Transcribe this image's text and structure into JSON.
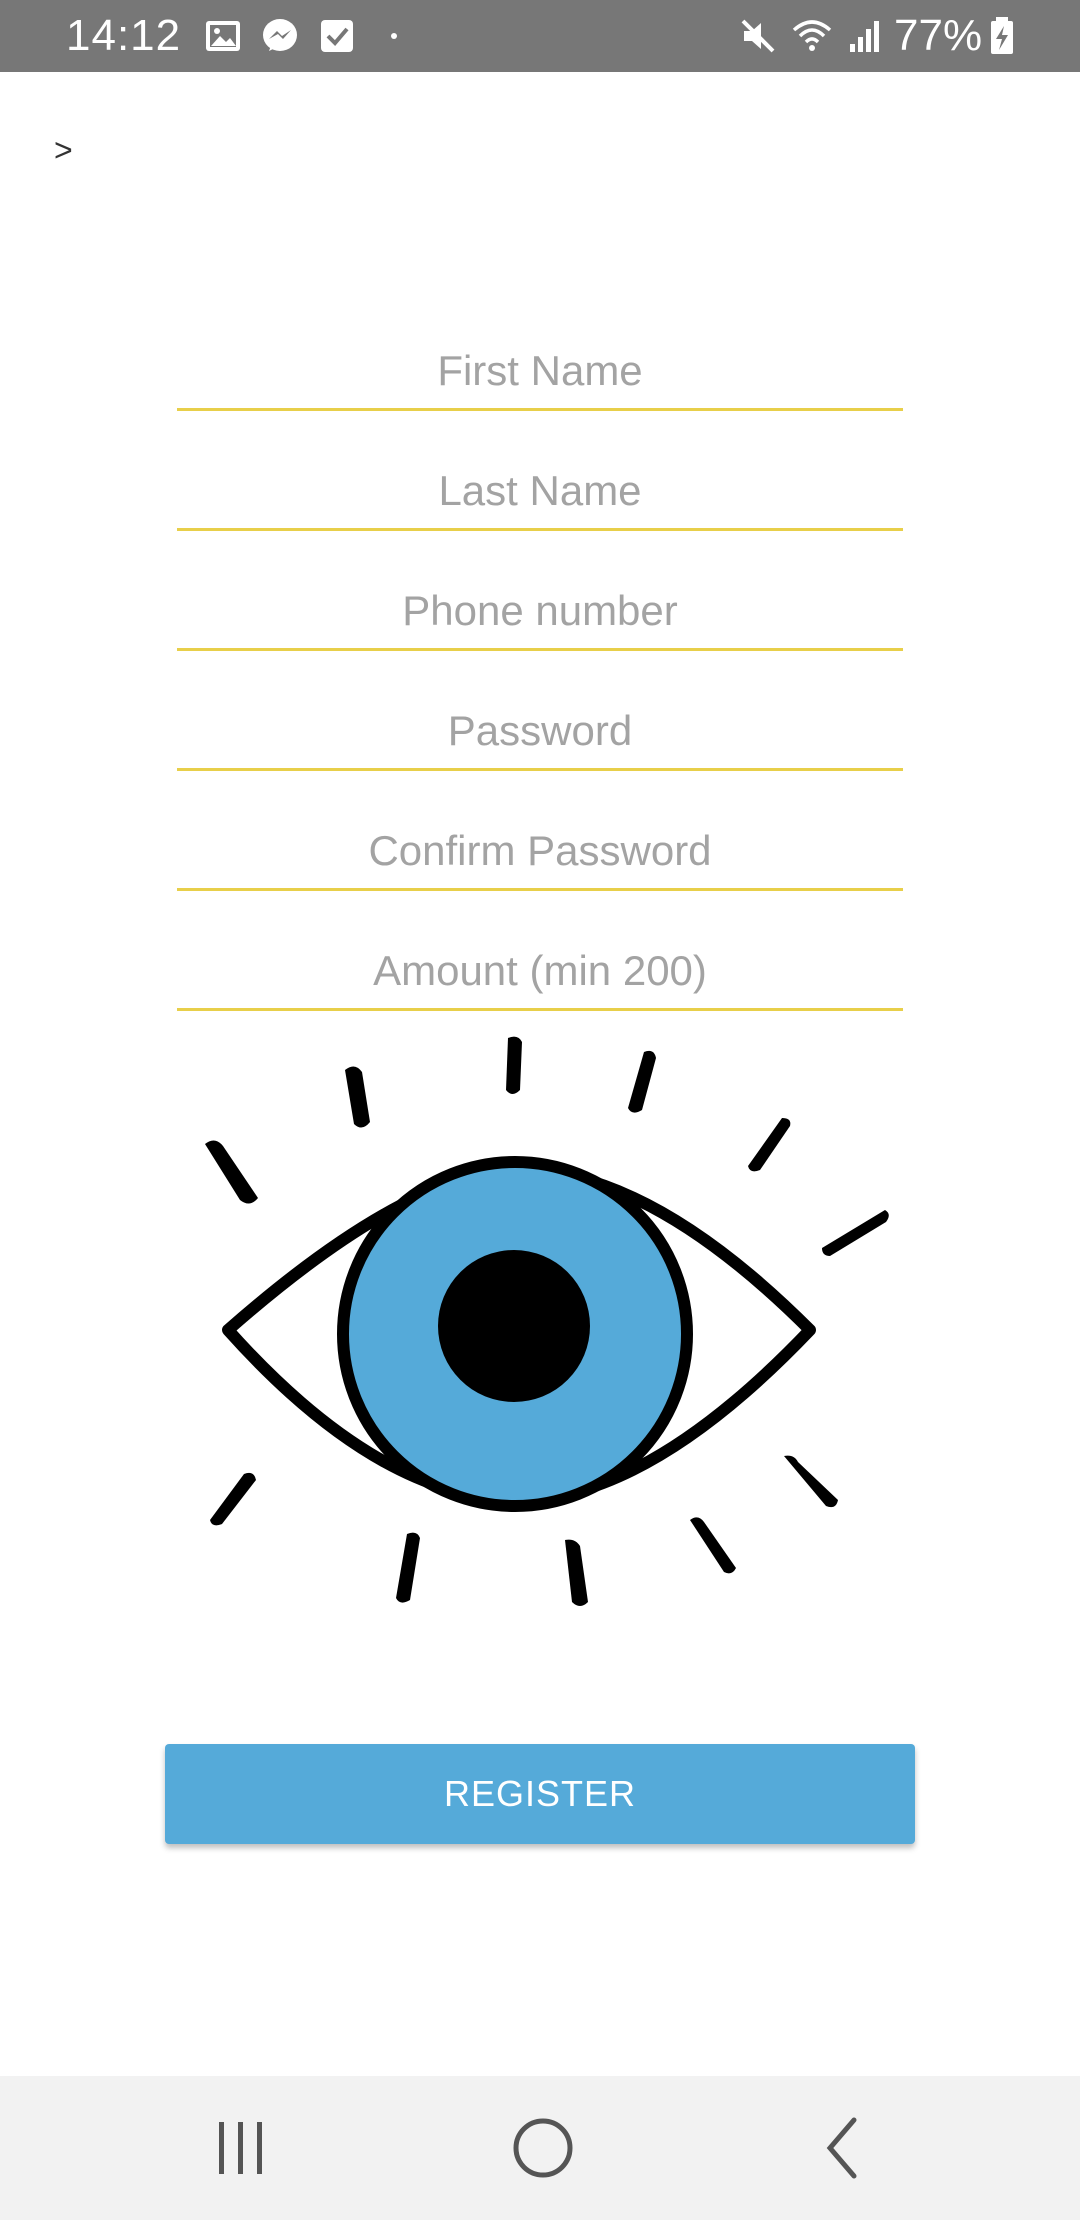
{
  "status_bar": {
    "time": "14:12",
    "battery": "77%",
    "icons": [
      "gallery-icon",
      "messenger-icon",
      "task-check-icon",
      "dot-icon",
      "mute-icon",
      "wifi-icon",
      "signal-icon",
      "battery-icon"
    ]
  },
  "header": {
    "back_label": ">"
  },
  "form": {
    "first_name": {
      "placeholder": "First Name",
      "value": ""
    },
    "last_name": {
      "placeholder": "Last Name",
      "value": ""
    },
    "phone": {
      "placeholder": "Phone number",
      "value": ""
    },
    "password": {
      "placeholder": "Password",
      "value": ""
    },
    "confirm_password": {
      "placeholder": "Confirm Password",
      "value": ""
    },
    "amount": {
      "placeholder": "Amount (min 200)",
      "value": ""
    }
  },
  "illustration": {
    "icon": "eye-icon",
    "iris_color": "#55aad9",
    "outline_color": "#000000"
  },
  "register_button": {
    "label": "REGISTER",
    "color": "#55aad9"
  },
  "colors": {
    "status_bar": "#777777",
    "field_underline": "#e8cf4a",
    "placeholder": "#a3a3a3",
    "nav_bar": "#f2f2f2"
  },
  "nav_bar": {
    "buttons": [
      "recent-apps-icon",
      "home-icon",
      "back-icon"
    ]
  }
}
